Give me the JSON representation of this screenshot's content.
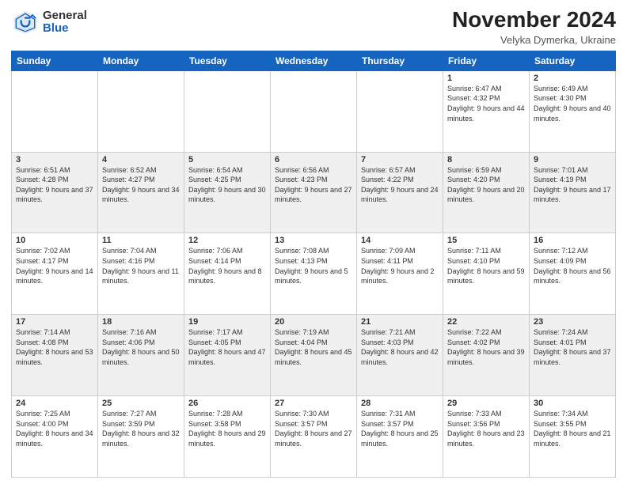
{
  "header": {
    "logo_general": "General",
    "logo_blue": "Blue",
    "month_title": "November 2024",
    "location": "Velyka Dymerka, Ukraine"
  },
  "days_of_week": [
    "Sunday",
    "Monday",
    "Tuesday",
    "Wednesday",
    "Thursday",
    "Friday",
    "Saturday"
  ],
  "weeks": [
    [
      {
        "day": "",
        "info": ""
      },
      {
        "day": "",
        "info": ""
      },
      {
        "day": "",
        "info": ""
      },
      {
        "day": "",
        "info": ""
      },
      {
        "day": "",
        "info": ""
      },
      {
        "day": "1",
        "info": "Sunrise: 6:47 AM\nSunset: 4:32 PM\nDaylight: 9 hours and 44 minutes."
      },
      {
        "day": "2",
        "info": "Sunrise: 6:49 AM\nSunset: 4:30 PM\nDaylight: 9 hours and 40 minutes."
      }
    ],
    [
      {
        "day": "3",
        "info": "Sunrise: 6:51 AM\nSunset: 4:28 PM\nDaylight: 9 hours and 37 minutes."
      },
      {
        "day": "4",
        "info": "Sunrise: 6:52 AM\nSunset: 4:27 PM\nDaylight: 9 hours and 34 minutes."
      },
      {
        "day": "5",
        "info": "Sunrise: 6:54 AM\nSunset: 4:25 PM\nDaylight: 9 hours and 30 minutes."
      },
      {
        "day": "6",
        "info": "Sunrise: 6:56 AM\nSunset: 4:23 PM\nDaylight: 9 hours and 27 minutes."
      },
      {
        "day": "7",
        "info": "Sunrise: 6:57 AM\nSunset: 4:22 PM\nDaylight: 9 hours and 24 minutes."
      },
      {
        "day": "8",
        "info": "Sunrise: 6:59 AM\nSunset: 4:20 PM\nDaylight: 9 hours and 20 minutes."
      },
      {
        "day": "9",
        "info": "Sunrise: 7:01 AM\nSunset: 4:19 PM\nDaylight: 9 hours and 17 minutes."
      }
    ],
    [
      {
        "day": "10",
        "info": "Sunrise: 7:02 AM\nSunset: 4:17 PM\nDaylight: 9 hours and 14 minutes."
      },
      {
        "day": "11",
        "info": "Sunrise: 7:04 AM\nSunset: 4:16 PM\nDaylight: 9 hours and 11 minutes."
      },
      {
        "day": "12",
        "info": "Sunrise: 7:06 AM\nSunset: 4:14 PM\nDaylight: 9 hours and 8 minutes."
      },
      {
        "day": "13",
        "info": "Sunrise: 7:08 AM\nSunset: 4:13 PM\nDaylight: 9 hours and 5 minutes."
      },
      {
        "day": "14",
        "info": "Sunrise: 7:09 AM\nSunset: 4:11 PM\nDaylight: 9 hours and 2 minutes."
      },
      {
        "day": "15",
        "info": "Sunrise: 7:11 AM\nSunset: 4:10 PM\nDaylight: 8 hours and 59 minutes."
      },
      {
        "day": "16",
        "info": "Sunrise: 7:12 AM\nSunset: 4:09 PM\nDaylight: 8 hours and 56 minutes."
      }
    ],
    [
      {
        "day": "17",
        "info": "Sunrise: 7:14 AM\nSunset: 4:08 PM\nDaylight: 8 hours and 53 minutes."
      },
      {
        "day": "18",
        "info": "Sunrise: 7:16 AM\nSunset: 4:06 PM\nDaylight: 8 hours and 50 minutes."
      },
      {
        "day": "19",
        "info": "Sunrise: 7:17 AM\nSunset: 4:05 PM\nDaylight: 8 hours and 47 minutes."
      },
      {
        "day": "20",
        "info": "Sunrise: 7:19 AM\nSunset: 4:04 PM\nDaylight: 8 hours and 45 minutes."
      },
      {
        "day": "21",
        "info": "Sunrise: 7:21 AM\nSunset: 4:03 PM\nDaylight: 8 hours and 42 minutes."
      },
      {
        "day": "22",
        "info": "Sunrise: 7:22 AM\nSunset: 4:02 PM\nDaylight: 8 hours and 39 minutes."
      },
      {
        "day": "23",
        "info": "Sunrise: 7:24 AM\nSunset: 4:01 PM\nDaylight: 8 hours and 37 minutes."
      }
    ],
    [
      {
        "day": "24",
        "info": "Sunrise: 7:25 AM\nSunset: 4:00 PM\nDaylight: 8 hours and 34 minutes."
      },
      {
        "day": "25",
        "info": "Sunrise: 7:27 AM\nSunset: 3:59 PM\nDaylight: 8 hours and 32 minutes."
      },
      {
        "day": "26",
        "info": "Sunrise: 7:28 AM\nSunset: 3:58 PM\nDaylight: 8 hours and 29 minutes."
      },
      {
        "day": "27",
        "info": "Sunrise: 7:30 AM\nSunset: 3:57 PM\nDaylight: 8 hours and 27 minutes."
      },
      {
        "day": "28",
        "info": "Sunrise: 7:31 AM\nSunset: 3:57 PM\nDaylight: 8 hours and 25 minutes."
      },
      {
        "day": "29",
        "info": "Sunrise: 7:33 AM\nSunset: 3:56 PM\nDaylight: 8 hours and 23 minutes."
      },
      {
        "day": "30",
        "info": "Sunrise: 7:34 AM\nSunset: 3:55 PM\nDaylight: 8 hours and 21 minutes."
      }
    ]
  ]
}
